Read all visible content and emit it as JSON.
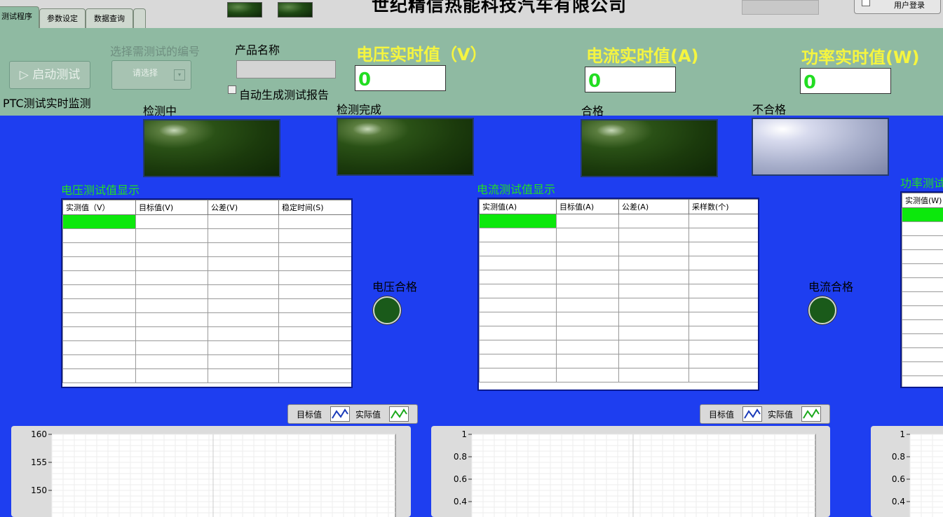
{
  "tabs": [
    {
      "label": "测试程序",
      "active": true
    },
    {
      "label": "参数设定",
      "active": false
    },
    {
      "label": "数据查询",
      "active": false
    }
  ],
  "company_name": "世纪精信热能科技汽车有限公司",
  "login_button": "用户登录",
  "start_button": "▷ 启动测试",
  "select_label": "选择需测试的编号",
  "select_placeholder": "请选择",
  "product_name_label": "产品名称",
  "product_name_value": "",
  "auto_report_label": "自动生成测试报告",
  "monitor_label": "PTC测试实时监测",
  "realtime": {
    "voltage": {
      "title": "电压实时值（V）",
      "value": "0"
    },
    "current": {
      "title": "电流实时值(A)",
      "value": "0"
    },
    "power": {
      "title": "功率实时值(W)",
      "value": "0"
    }
  },
  "status": [
    {
      "label": "检测中",
      "state": "off"
    },
    {
      "label": "检测完成",
      "state": "off"
    },
    {
      "label": "合格",
      "state": "off"
    },
    {
      "label": "不合格",
      "state": "on"
    }
  ],
  "voltage_table": {
    "title": "电压测试值显示",
    "columns": [
      "实测值（V）",
      "目标值(V)",
      "公差(V)",
      "稳定时间(S)"
    ]
  },
  "current_table": {
    "title": "电流测试值显示",
    "columns": [
      "实测值(A)",
      "目标值(A)",
      "公差(A)",
      "采样数(个)"
    ]
  },
  "power_table": {
    "title": "功率测试",
    "columns": [
      "实测值(W)"
    ]
  },
  "voltage_pass_label": "电压合格",
  "current_pass_label": "电流合格",
  "legend": {
    "target": "目标值",
    "actual": "实际值"
  },
  "charts": [
    {
      "ticks": [
        "160",
        "155",
        "150"
      ]
    },
    {
      "ticks": [
        "1",
        "0.8",
        "0.6",
        "0.4"
      ]
    },
    {
      "ticks": [
        "1",
        "0.8",
        "0.6",
        "0.4"
      ]
    }
  ],
  "colors": {
    "background": "#1e3ef0",
    "header": "#8fbaa2",
    "accent_yellow": "#f5f540",
    "accent_green": "#22e022"
  }
}
